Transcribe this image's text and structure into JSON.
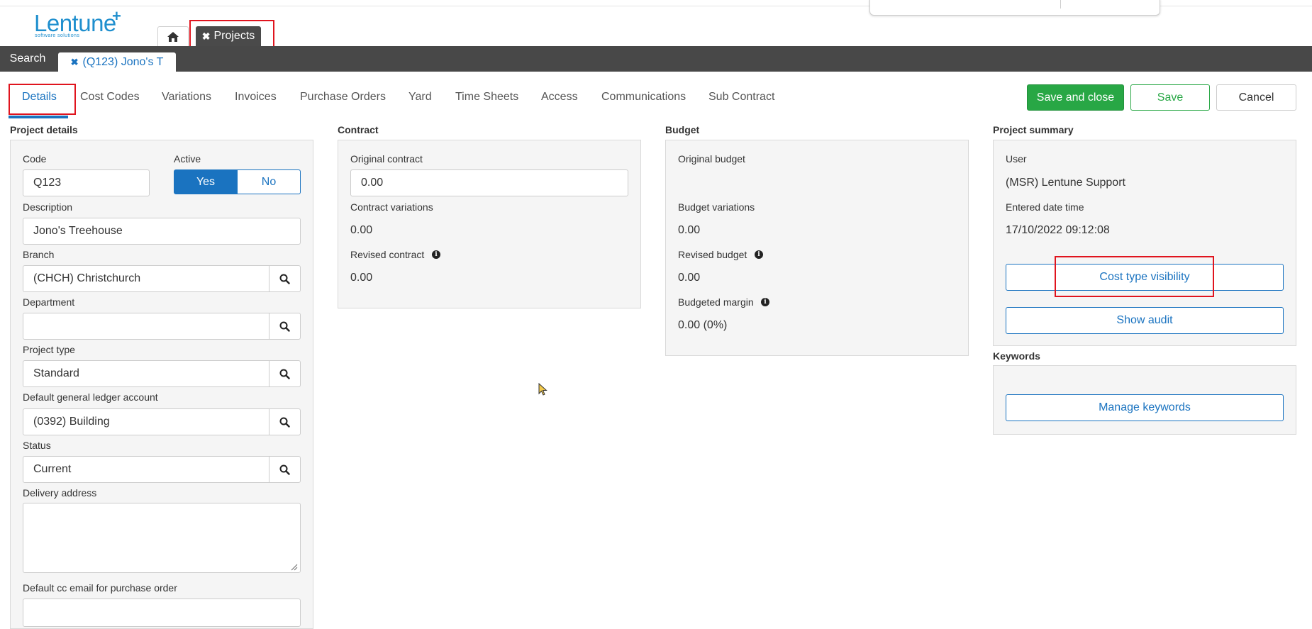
{
  "logo": {
    "word": "Lentune",
    "plus": "+",
    "sub": "software solutions"
  },
  "tabs": {
    "projects_label": "Projects",
    "search_label": "Search",
    "record_label": "(Q123) Jono's T"
  },
  "subtabs": [
    "Details",
    "Cost Codes",
    "Variations",
    "Invoices",
    "Purchase Orders",
    "Yard",
    "Time Sheets",
    "Access",
    "Communications",
    "Sub Contract"
  ],
  "actions": {
    "save_close": "Save and close",
    "save": "Save",
    "cancel": "Cancel"
  },
  "project_details": {
    "title": "Project details",
    "code_label": "Code",
    "code_value": "Q123",
    "active_label": "Active",
    "yes": "Yes",
    "no": "No",
    "description_label": "Description",
    "description_value": "Jono's Treehouse",
    "branch_label": "Branch",
    "branch_value": "(CHCH) Christchurch",
    "department_label": "Department",
    "department_value": "",
    "project_type_label": "Project type",
    "project_type_value": "Standard",
    "gl_label": "Default general ledger account",
    "gl_value": "(0392) Building",
    "status_label": "Status",
    "status_value": "Current",
    "delivery_label": "Delivery address",
    "delivery_value": "",
    "cc_email_label": "Default cc email for purchase order",
    "cc_email_value": ""
  },
  "contract": {
    "title": "Contract",
    "original_label": "Original contract",
    "original_value": "0.00",
    "variations_label": "Contract variations",
    "variations_value": "0.00",
    "revised_label": "Revised contract",
    "revised_value": "0.00"
  },
  "budget": {
    "title": "Budget",
    "original_label": "Original budget",
    "variations_label": "Budget variations",
    "variations_value": "0.00",
    "revised_label": "Revised budget",
    "revised_value": "0.00",
    "margin_label": "Budgeted margin",
    "margin_value": "0.00 (0%)"
  },
  "summary": {
    "title": "Project summary",
    "user_label": "User",
    "user_value": "(MSR) Lentune Support",
    "date_label": "Entered date time",
    "date_value": "17/10/2022 09:12:08",
    "cost_type_button": "Cost type visibility",
    "audit_button": "Show audit"
  },
  "keywords": {
    "title": "Keywords",
    "manage_button": "Manage keywords"
  },
  "colors": {
    "accent": "#1a73c0",
    "save_green": "#28a745",
    "tab_bar": "#484848",
    "highlight_red": "#e0141e"
  }
}
